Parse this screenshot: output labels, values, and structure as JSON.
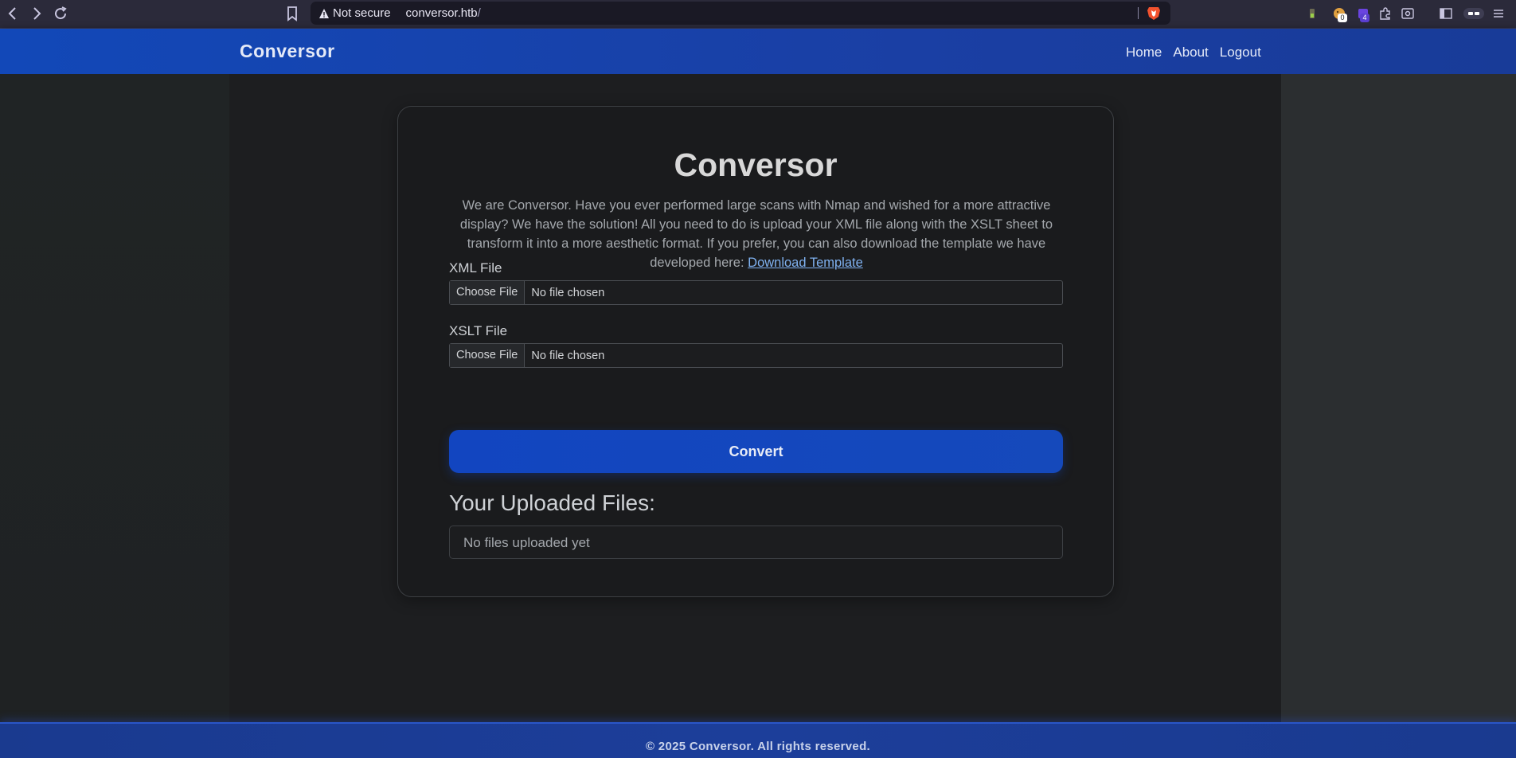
{
  "browser": {
    "security_label": "Not secure",
    "url_host": "conversor.htb",
    "url_path": "/",
    "badges": {
      "ext1": "0",
      "ext2": "4"
    }
  },
  "nav": {
    "brand": "Conversor",
    "links": [
      "Home",
      "About",
      "Logout"
    ]
  },
  "card": {
    "title": "Conversor",
    "description": "We are Conversor. Have you ever performed large scans with Nmap and wished for a more attractive display? We have the solution! All you need to do is upload your XML file along with the XSLT sheet to transform it into a more aesthetic format. If you prefer, you can also download the template we have developed here:",
    "template_link": "Download Template",
    "xml_label": "XML File",
    "xslt_label": "XSLT File",
    "choose_file_label": "Choose File",
    "no_file_text": "No file chosen",
    "convert_label": "Convert",
    "uploads_title": "Your Uploaded Files:",
    "uploads_empty": "No files uploaded yet"
  },
  "footer": {
    "text": "© 2025 Conversor. All rights reserved."
  },
  "colors": {
    "nav_bg": "#1a3fa4",
    "button": "#1245c0",
    "link": "#7fb1f0",
    "page_bg": "#1d1e20"
  }
}
